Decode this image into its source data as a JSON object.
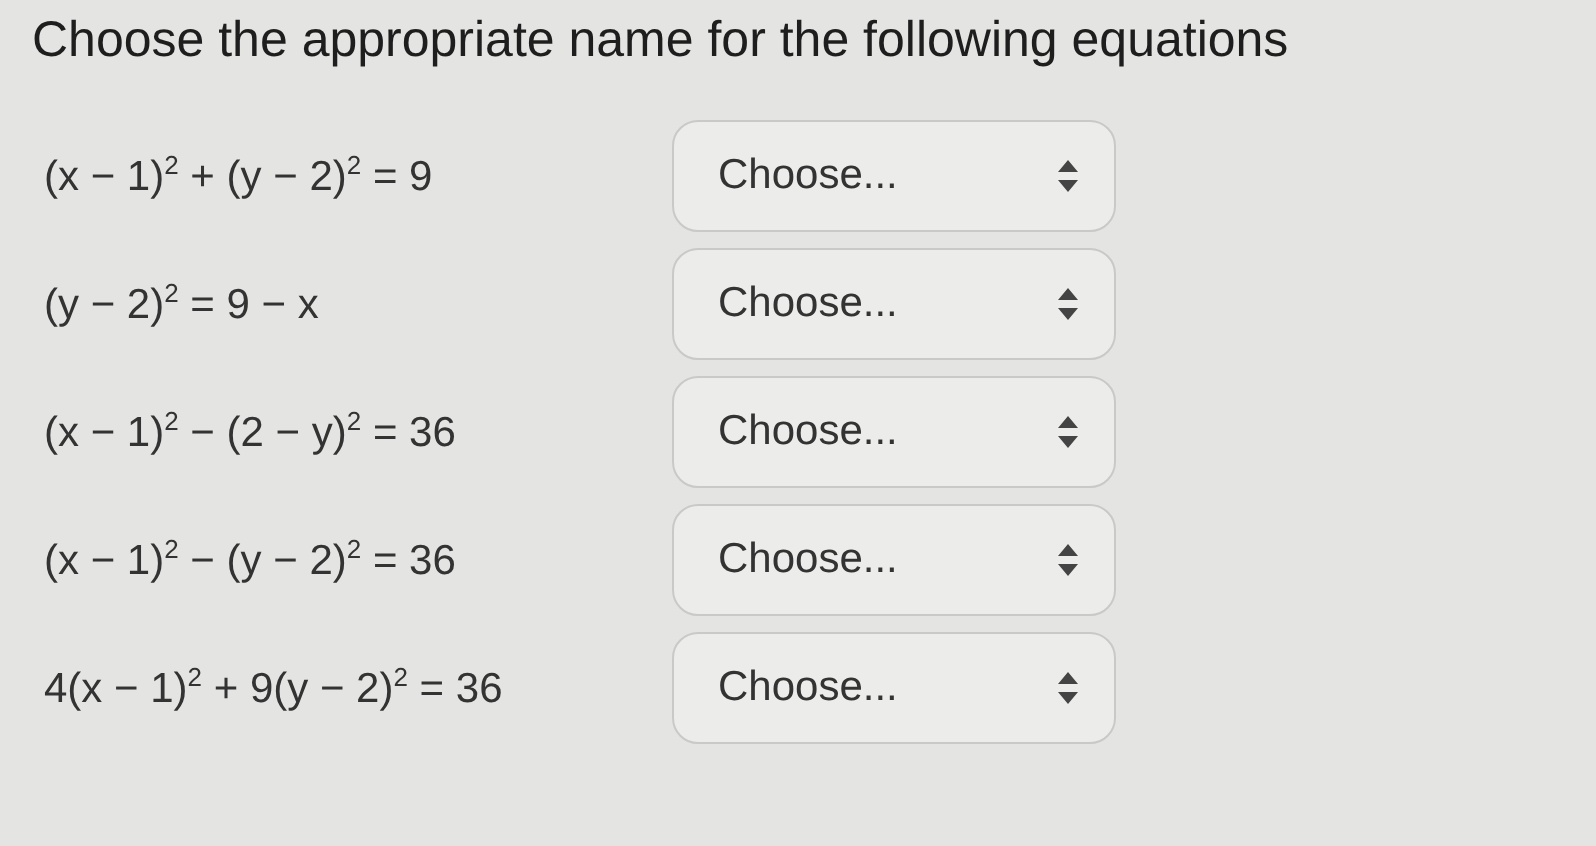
{
  "title": "Choose the appropriate name for the following equations",
  "rows": [
    {
      "equation": "(x − 1)$^{2}$ + (y − 2)$^{2}$ = 9",
      "select": {
        "value": "Choose..."
      }
    },
    {
      "equation": "(y − 2)$^{2}$ = 9 − x",
      "select": {
        "value": "Choose..."
      }
    },
    {
      "equation": "(x − 1)$^{2}$ − (2 − y)$^{2}$ = 36",
      "select": {
        "value": "Choose..."
      }
    },
    {
      "equation": "(x − 1)$^{2}$ − (y − 2)$^{2}$ = 36",
      "select": {
        "value": "Choose..."
      }
    },
    {
      "equation": "4(x − 1)$^{2}$ + 9(y − 2)$^{2}$ = 36",
      "select": {
        "value": "Choose..."
      }
    }
  ]
}
